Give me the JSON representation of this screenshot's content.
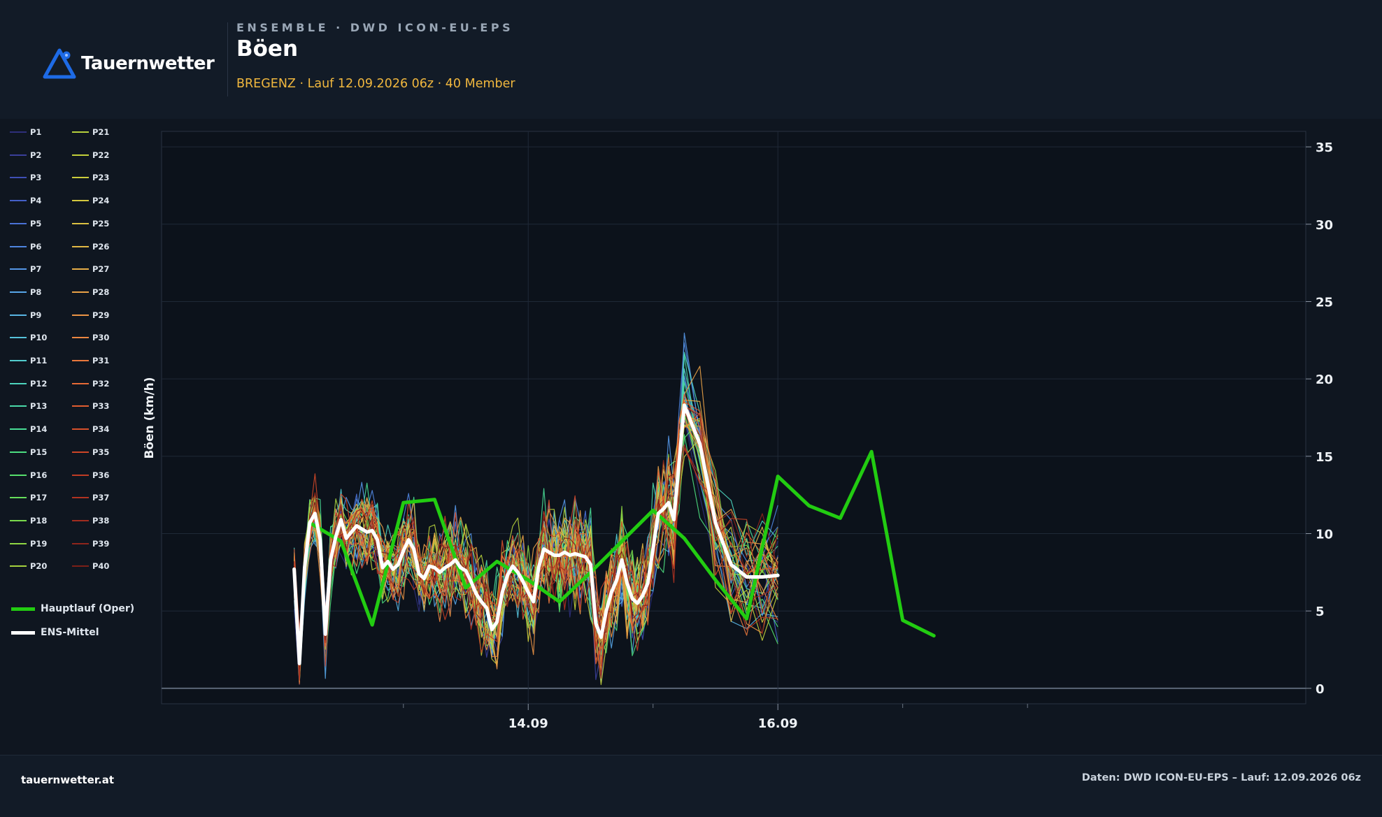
{
  "header": {
    "logo_text": "Tauernwetter",
    "kicker": "ENSEMBLE · DWD ICON-EU-EPS",
    "title": "Böen",
    "subtitle": "BREGENZ · Lauf 12.09.2026 06z · 40 Member"
  },
  "colors": {
    "oper": "#22cc11",
    "mean": "#ffffff",
    "accent": "#f0b73e",
    "logo": "#1e6be6"
  },
  "legend": {
    "oper_label": "Hauptlauf (Oper)",
    "mean_label": "ENS-Mittel"
  },
  "footer": {
    "site": "tauernwetter.at",
    "source": "Daten: DWD ICON-EU-EPS – Lauf: 12.09.2026 06z"
  },
  "chart_data": {
    "type": "line",
    "ylabel": "Böen (km/h)",
    "ylim": [
      -1,
      36
    ],
    "yticks": [
      0,
      5,
      10,
      15,
      20,
      25,
      30,
      35
    ],
    "xlim": [
      -28.5,
      191.5
    ],
    "x_unit": "hours since 12.09.2026 06z",
    "xticks": [
      {
        "x": 42,
        "label": "14.09"
      },
      {
        "x": 90,
        "label": "16.09"
      }
    ],
    "xminor": [
      18,
      66,
      114,
      138
    ],
    "grid": true,
    "legend_position": "left",
    "member_names": [
      "P1",
      "P2",
      "P3",
      "P4",
      "P5",
      "P6",
      "P7",
      "P8",
      "P9",
      "P10",
      "P11",
      "P12",
      "P13",
      "P14",
      "P15",
      "P16",
      "P17",
      "P18",
      "P19",
      "P20",
      "P21",
      "P22",
      "P23",
      "P24",
      "P25",
      "P26",
      "P27",
      "P28",
      "P29",
      "P30",
      "P31",
      "P32",
      "P33",
      "P34",
      "P35",
      "P36",
      "P37",
      "P38",
      "P39",
      "P40"
    ],
    "member_colors": [
      "#2e2f7a",
      "#3a3f9a",
      "#3f4fb5",
      "#4460c8",
      "#4a72d6",
      "#4f85df",
      "#5496e6",
      "#57a6e8",
      "#58b5e3",
      "#56c2da",
      "#52ccce",
      "#4dd4bd",
      "#49d9a9",
      "#48dc95",
      "#4cde80",
      "#56df6c",
      "#66de5a",
      "#7adb4c",
      "#8fd743",
      "#a4d13e",
      "#b6d03c",
      "#c2cf3a",
      "#cccd3b",
      "#d4c83e",
      "#dbc142",
      "#e1b845",
      "#e6ad47",
      "#e9a147",
      "#eb9445",
      "#ec8641",
      "#ea783c",
      "#e66a36",
      "#e05d30",
      "#d8512b",
      "#cd4627",
      "#c03c24",
      "#b13321",
      "#a12c1f",
      "#8f251c",
      "#7c1f18"
    ],
    "x_members": [
      -3,
      -2,
      -1,
      0,
      1,
      2,
      3,
      4,
      5,
      6,
      7,
      8,
      9,
      10,
      11,
      12,
      13,
      14,
      15,
      16,
      17,
      18,
      19,
      20,
      21,
      22,
      23,
      24,
      25,
      26,
      27,
      28,
      29,
      30,
      31,
      32,
      33,
      34,
      35,
      36,
      37,
      38,
      39,
      40,
      41,
      42,
      43,
      44,
      45,
      46,
      47,
      48,
      49,
      50,
      51,
      52,
      53,
      54,
      55,
      56,
      57,
      58,
      59,
      60,
      61,
      62,
      63,
      64,
      65,
      66,
      67,
      68,
      69,
      70,
      71,
      72,
      75,
      78,
      81,
      84,
      87,
      90,
      93,
      96,
      99,
      102,
      105,
      108,
      111,
      114,
      117,
      120
    ],
    "ens_mean": [
      7.7,
      1.6,
      7.8,
      10.7,
      11.3,
      9.6,
      3.5,
      8.3,
      9.8,
      10.9,
      9.7,
      10.1,
      10.5,
      10.3,
      10.1,
      10.2,
      9.6,
      7.8,
      8.2,
      7.7,
      8.0,
      8.9,
      9.6,
      9.0,
      7.4,
      7.1,
      7.9,
      7.8,
      7.5,
      7.8,
      8.0,
      8.3,
      7.8,
      7.6,
      6.9,
      6.1,
      5.6,
      5.2,
      3.8,
      4.3,
      6.2,
      7.3,
      7.9,
      7.5,
      6.9,
      6.2,
      5.6,
      7.8,
      9.0,
      8.8,
      8.6,
      8.6,
      8.8,
      8.6,
      8.7,
      8.6,
      8.5,
      8.0,
      4.2,
      3.3,
      5.0,
      6.2,
      7.0,
      8.3,
      6.8,
      5.8,
      5.5,
      6.0,
      6.8,
      9.0,
      11.3,
      11.6,
      12.0,
      10.9,
      14.6,
      18.3,
      15.8,
      10.7,
      8.0,
      7.2,
      7.2,
      7.3
    ],
    "oper_x": [
      0,
      6,
      12,
      18,
      24,
      30,
      36,
      42,
      48,
      54,
      60,
      66,
      72,
      78,
      84,
      90,
      96,
      102,
      108,
      114,
      120
    ],
    "oper": [
      10.7,
      9.5,
      4.1,
      12.0,
      12.2,
      6.5,
      8.2,
      7.0,
      5.6,
      7.5,
      9.5,
      11.5,
      9.7,
      7.0,
      4.5,
      13.7,
      11.8,
      11.0,
      15.3,
      4.4,
      3.4
    ]
  }
}
